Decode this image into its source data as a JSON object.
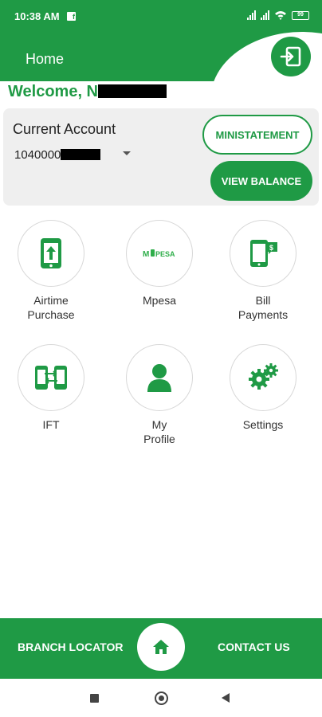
{
  "status_bar": {
    "time": "10:38 AM",
    "battery": "99"
  },
  "header": {
    "title": "Home"
  },
  "welcome": {
    "text": "Welcome, NI"
  },
  "account": {
    "type": "Current Account",
    "number_visible": "1040000",
    "ministatement_label": "MINISTATEMENT",
    "view_balance_label": "VIEW BALANCE"
  },
  "tiles": [
    {
      "label": "Airtime\nPurchase",
      "icon": "phone-topup-icon"
    },
    {
      "label": "Mpesa",
      "icon": "mpesa-logo"
    },
    {
      "label": "Bill\nPayments",
      "icon": "bill-payment-icon"
    },
    {
      "label": "IFT",
      "icon": "transfer-icon"
    },
    {
      "label": "My\nProfile",
      "icon": "user-icon"
    },
    {
      "label": "Settings",
      "icon": "gears-icon"
    }
  ],
  "bottom_nav": {
    "left": "BRANCH LOCATOR",
    "right": "CONTACT US"
  },
  "colors": {
    "primary": "#1f9a45",
    "card": "#efefef"
  }
}
